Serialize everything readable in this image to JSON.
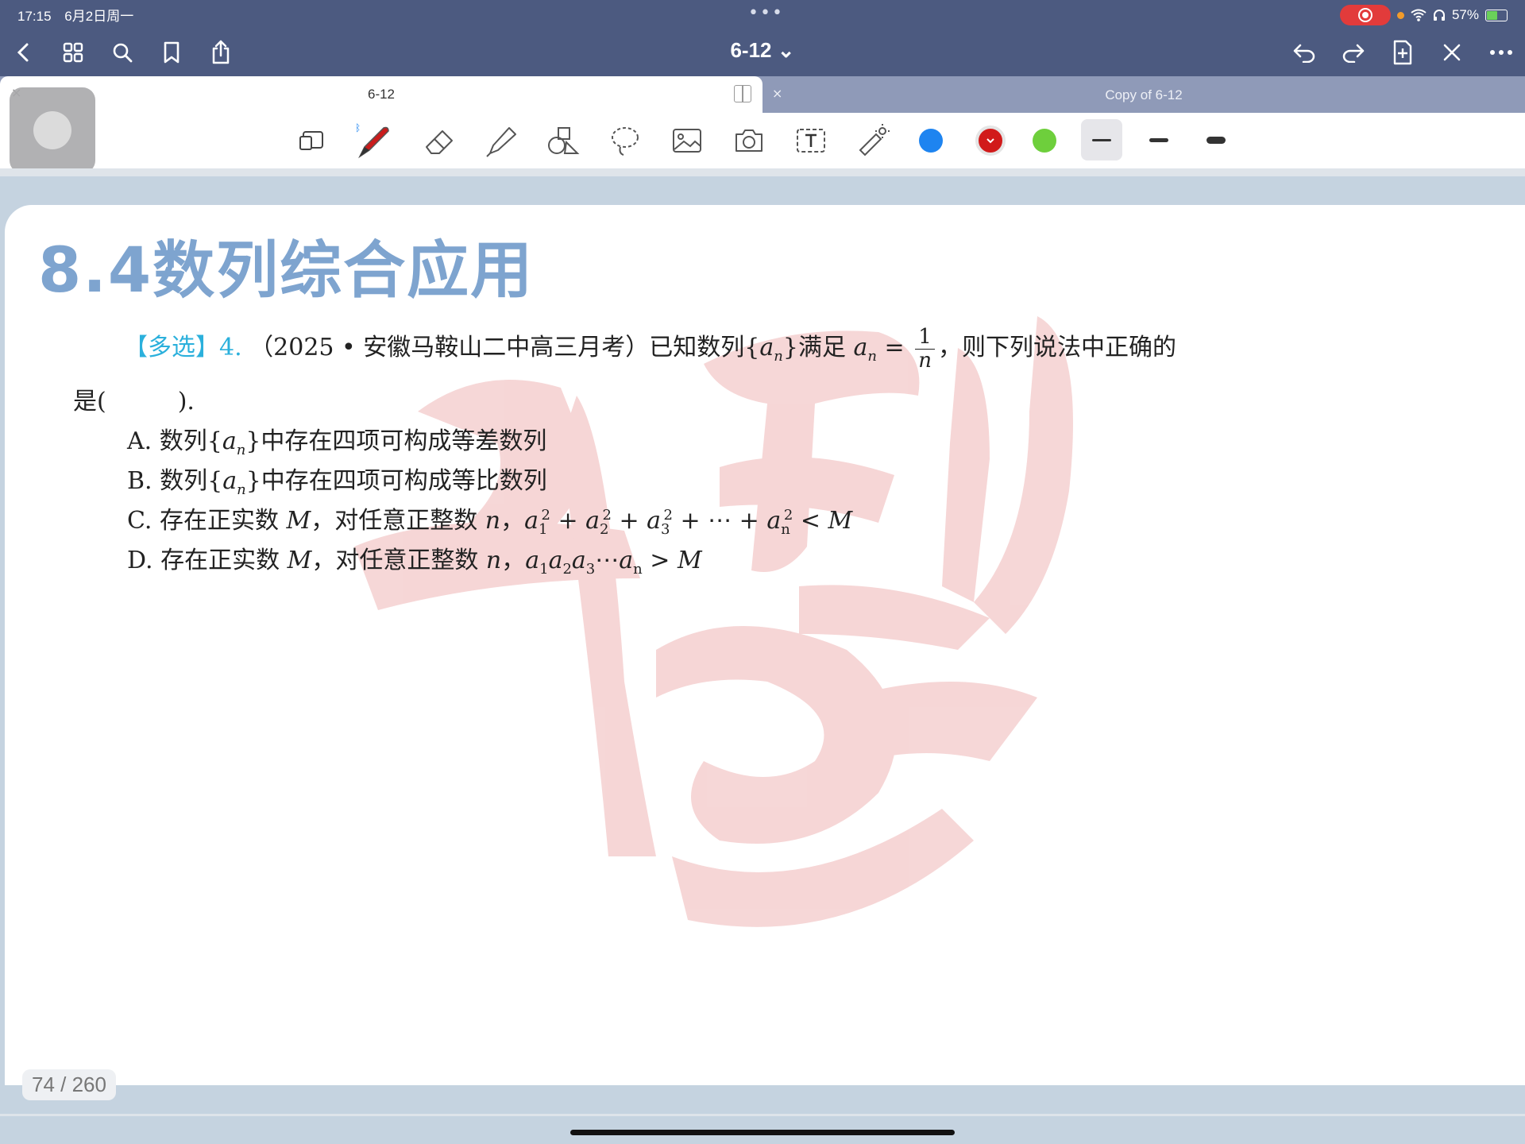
{
  "status": {
    "time": "17:15",
    "date": "6月2日周一",
    "battery": "57%"
  },
  "header": {
    "title": "6-12 ⌄",
    "nav_icons": [
      "back-icon",
      "grid-icon",
      "search-icon",
      "bookmark-icon",
      "share-icon"
    ],
    "right_icons": [
      "undo-icon",
      "redo-icon",
      "add-page-icon",
      "close-icon",
      "more-icon"
    ]
  },
  "tabs": [
    {
      "label": "6-12",
      "active": true
    },
    {
      "label": "Copy of 6-12",
      "active": false
    }
  ],
  "toolbar": {
    "tools": [
      "zoom-select-icon",
      "pen-icon",
      "eraser-icon",
      "highlighter-icon",
      "shapes-icon",
      "lasso-icon",
      "image-icon",
      "camera-icon",
      "text-icon",
      "laser-pointer-icon"
    ],
    "colors": [
      "#1e84f0",
      "#d11a1a",
      "#6ecf3c"
    ],
    "selected_color_index": 1,
    "stroke_widths": [
      "thin",
      "medium",
      "thick"
    ],
    "selected_width_index": 0
  },
  "page": {
    "heading": "8.4数列综合应用",
    "question": {
      "tag": "【多选】",
      "number": "4.",
      "source": "（2025 • 安徽马鞍山二中高三月考）已知数列{",
      "mid": "}满足",
      "then": "，则下列说法中正确的",
      "line2": "是(　　　)."
    },
    "options": {
      "A": {
        "label": "A.",
        "text1": "数列{",
        "text2": "}中存在四项可构成等差数列"
      },
      "B": {
        "label": "B.",
        "text1": "数列{",
        "text2": "}中存在四项可构成等比数列"
      },
      "C": {
        "label": "C.",
        "text1": "存在正实数",
        "text2": "，对任意正整数",
        "ineq": "< M"
      },
      "D": {
        "label": "D.",
        "text1": "存在正实数",
        "text2": "，对任意正整数",
        "ineq": "> M"
      }
    },
    "page_number": "74 / 260"
  }
}
